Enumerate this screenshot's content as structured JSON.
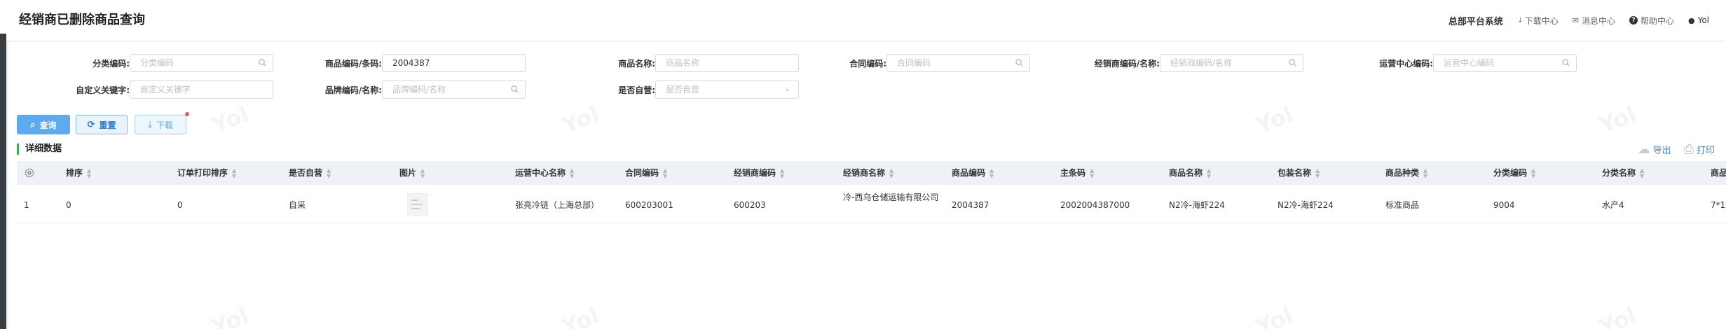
{
  "header": {
    "title": "经销商已删除商品查询",
    "platform": "总部平台系统",
    "download_center": "下载中心",
    "message_center": "消息中心",
    "help_center": "帮助中心",
    "user": "Yol"
  },
  "watermark": "Yol",
  "filters": {
    "category_code": {
      "label": "分类编码:",
      "placeholder": "分类编码"
    },
    "product_code": {
      "label": "商品编码/条码:",
      "value": "2004387"
    },
    "product_name": {
      "label": "商品名称:",
      "placeholder": "商品名称"
    },
    "contract_code": {
      "label": "合同编码:",
      "placeholder": "合同编码"
    },
    "dealer": {
      "label": "经销商编码/名称:",
      "placeholder": "经销商编码/名称"
    },
    "ops_center": {
      "label": "运营中心编码:",
      "placeholder": "运营中心编码"
    },
    "custom_keyword": {
      "label": "自定义关键字:",
      "placeholder": "自定义关键字"
    },
    "brand": {
      "label": "品牌编码/名称:",
      "placeholder": "品牌编码/名称"
    },
    "self_operated": {
      "label": "是否自营:",
      "placeholder": "是否自营"
    }
  },
  "buttons": {
    "query": "查询",
    "reset": "重置",
    "download": "下载"
  },
  "section": {
    "title": "详细数据",
    "export": "导出",
    "print": "打印"
  },
  "table": {
    "columns": [
      "排序",
      "订单打印排序",
      "是否自营",
      "图片",
      "运营中心名称",
      "合同编码",
      "经销商编码",
      "经销商名称",
      "商品编码",
      "主条码",
      "商品名称",
      "包装名称",
      "商品种类",
      "分类编码",
      "分类名称",
      "商品"
    ],
    "rows": [
      {
        "index": "1",
        "sort": "0",
        "print_sort": "0",
        "self_operated": "自采",
        "ops_center": "张亮冷链（上海总部）",
        "contract": "600203001",
        "dealer_code": "600203",
        "dealer_name": "冷-西乌仓储运输有限公司",
        "product_code": "2004387",
        "barcode": "2002004387000",
        "product_name": "N2冷-海虾224",
        "package_name": "N2冷-海虾224",
        "product_type": "标准商品",
        "category_code": "9004",
        "category_name": "水产4",
        "extra": "7*1"
      }
    ]
  }
}
